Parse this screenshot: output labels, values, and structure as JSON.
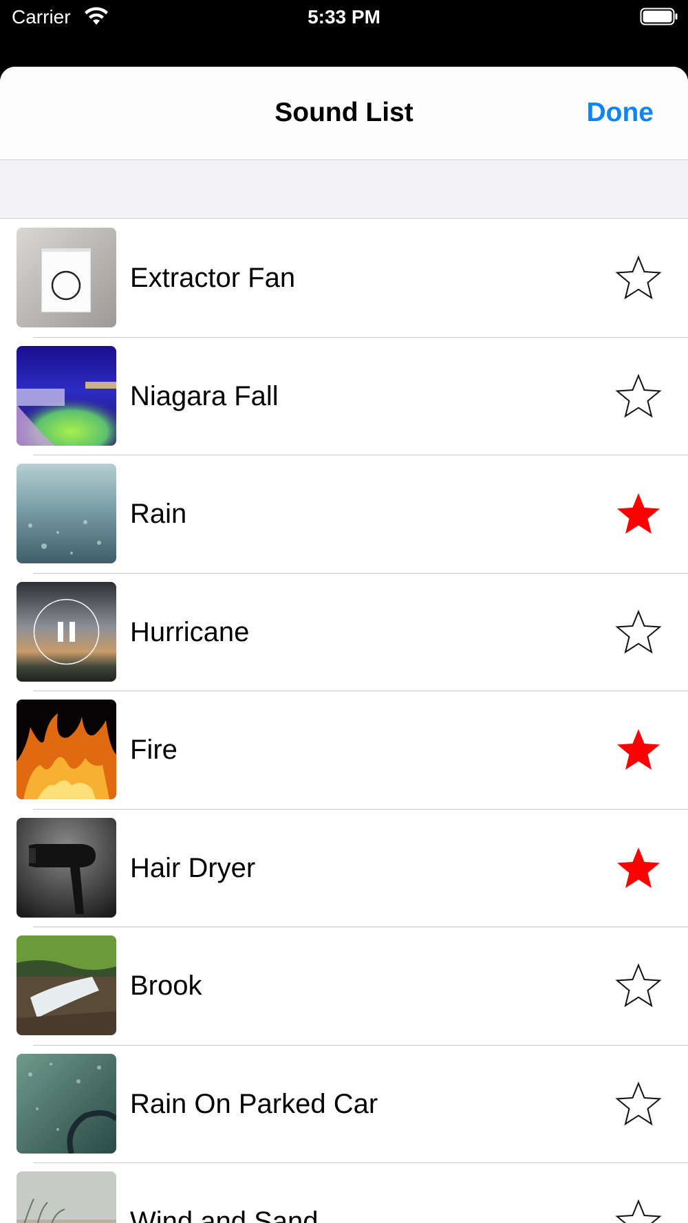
{
  "status_bar": {
    "carrier": "Carrier",
    "time": "5:33 PM",
    "wifi_icon": "wifi-icon",
    "battery_icon": "battery-icon"
  },
  "nav": {
    "title": "Sound List",
    "done_label": "Done"
  },
  "colors": {
    "accent": "#0a84ff",
    "favorite": "#ff0000"
  },
  "sounds": [
    {
      "label": "Extractor Fan",
      "favorite": false,
      "playing": false
    },
    {
      "label": "Niagara Fall",
      "favorite": false,
      "playing": false
    },
    {
      "label": "Rain",
      "favorite": true,
      "playing": false
    },
    {
      "label": "Hurricane",
      "favorite": false,
      "playing": true
    },
    {
      "label": "Fire",
      "favorite": true,
      "playing": false
    },
    {
      "label": "Hair Dryer",
      "favorite": true,
      "playing": false
    },
    {
      "label": "Brook",
      "favorite": false,
      "playing": false
    },
    {
      "label": "Rain On Parked Car",
      "favorite": false,
      "playing": false
    },
    {
      "label": "Wind and Sand",
      "favorite": false,
      "playing": false
    }
  ]
}
